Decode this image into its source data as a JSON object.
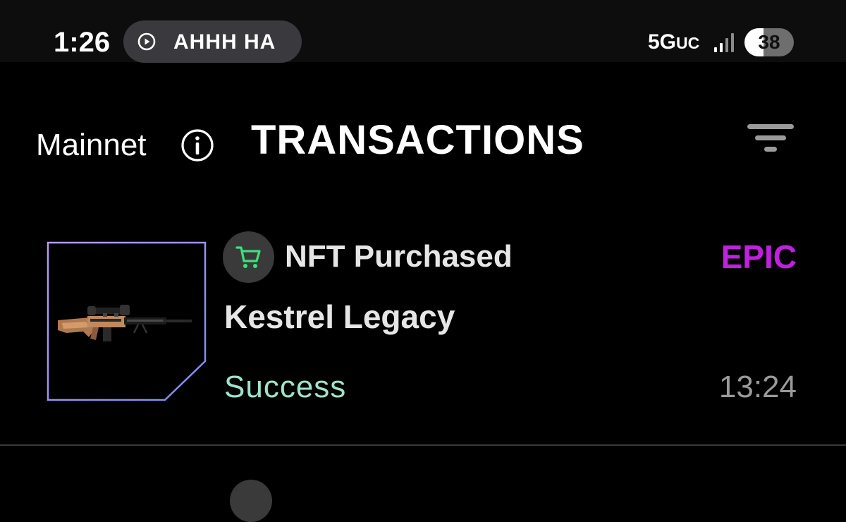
{
  "status_bar": {
    "time": "1:26",
    "now_playing_label": "AHHH HA",
    "network_main": "5G",
    "network_suffix": "UC",
    "battery": "38",
    "icons": {
      "play": "play-circle-icon",
      "signal": "cellular-signal-icon",
      "battery": "battery-icon"
    }
  },
  "header": {
    "network_label": "Mainnet",
    "title": "TRANSACTIONS",
    "icons": {
      "info": "info-icon",
      "filter": "filter-icon"
    }
  },
  "transactions": [
    {
      "type_label": "NFT Purchased",
      "rarity": "EPIC",
      "item_name": "Kestrel Legacy",
      "status": "Success",
      "time": "13:24",
      "icons": {
        "type": "cart-icon",
        "thumbnail": "sniper-rifle-image"
      }
    }
  ],
  "colors": {
    "background": "#000000",
    "rarity_epic": "#c020e0",
    "status_success": "#9fe3cc",
    "cart_green": "#3ee07a",
    "thumb_border_start": "#b89cf0",
    "thumb_border_end": "#7f8af5"
  }
}
